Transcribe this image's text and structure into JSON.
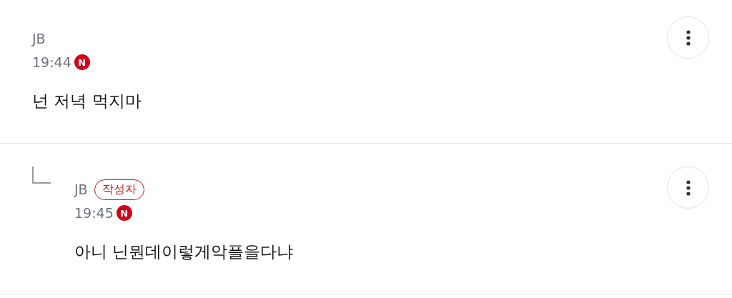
{
  "comments": [
    {
      "kind": "comment",
      "author": "JB",
      "time": "19:44",
      "new_mark": "N",
      "text": "넌 저녁 먹지마"
    },
    {
      "kind": "reply",
      "author": "JB",
      "author_tag": "작성자",
      "time": "19:45",
      "new_mark": "N",
      "text": "아니 닌뭔데이렇게악플을다냐"
    }
  ]
}
